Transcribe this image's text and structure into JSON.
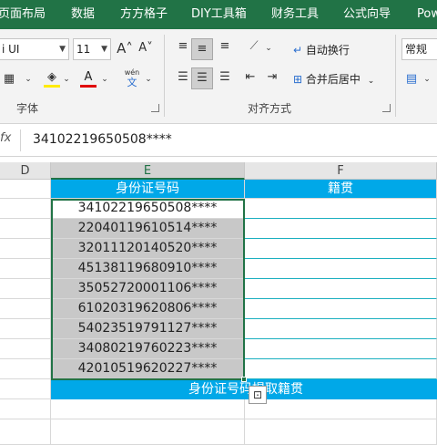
{
  "ribbon_tabs": [
    "页面布局",
    "数据",
    "方方格子",
    "DIY工具箱",
    "财务工具",
    "公式向导",
    "Pow"
  ],
  "font": {
    "name_value": "i UI",
    "size_value": "11",
    "grow_label": "A˄",
    "shrink_label": "A˅",
    "wen_top": "wén",
    "wen_bottom": "文",
    "group_label": "字体"
  },
  "alignment": {
    "wrap_text_label": "自动换行",
    "merge_center_label": "合并后居中",
    "group_label": "对齐方式"
  },
  "number": {
    "format_value": "常规"
  },
  "formula_bar": {
    "fx_label": "fx",
    "value": "34102219650508****"
  },
  "columns": [
    "D",
    "E",
    "F"
  ],
  "sheet": {
    "header_e": "身份证号码",
    "header_f": "籍贯",
    "ids": [
      "34102219650508****",
      "22040119610514****",
      "32011120140520****",
      "45138119680910****",
      "35052720001106****",
      "61020319620806****",
      "54023519791127****",
      "34080219760223****",
      "42010519620227****"
    ],
    "banner_text": "身份证号码提取籍贯"
  },
  "colors": {
    "ribbon_green": "#217346",
    "header_blue": "#00a8e8",
    "selection_gray": "#c8c8c8"
  }
}
